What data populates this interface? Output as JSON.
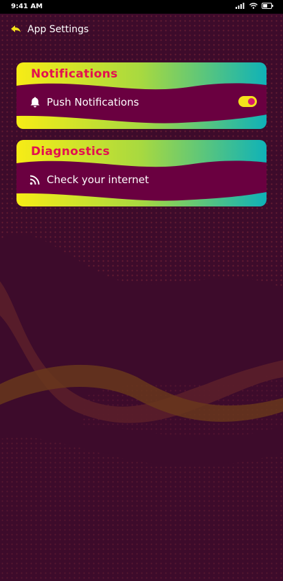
{
  "status_bar": {
    "time": "9:41 AM",
    "icons": [
      "signal-icon",
      "wifi-icon",
      "battery-icon"
    ]
  },
  "header": {
    "back_icon": "back-arrow-icon",
    "title": "App Settings"
  },
  "cards": {
    "notifications": {
      "title": "Notifications",
      "row": {
        "icon": "bell-icon",
        "label": "Push Notifications",
        "toggle_on": true
      }
    },
    "diagnostics": {
      "title": "Diagnostics",
      "row": {
        "icon": "rss-feed-icon",
        "label": "Check your internet"
      }
    }
  },
  "colors": {
    "background": "#3d0b2b",
    "card_body": "#6a0040",
    "card_title": "#e3104f",
    "gradient_start": "#f7ec16",
    "gradient_end": "#0fb2b8",
    "toggle_track": "#f4e21b",
    "toggle_knob": "#d91a6b",
    "accent_yellow": "#f2e01a"
  }
}
